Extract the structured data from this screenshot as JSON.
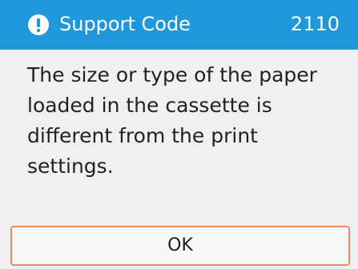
{
  "header": {
    "icon": "exclamation-circle-icon",
    "title": "Support Code",
    "code": "2110",
    "background_color": "#1f98db"
  },
  "message": {
    "text": "The size or type of the paper\nloaded in the cassette is\ndifferent from the print settings."
  },
  "actions": {
    "ok_label": "OK",
    "ok_border_color": "#ee8a5f"
  }
}
